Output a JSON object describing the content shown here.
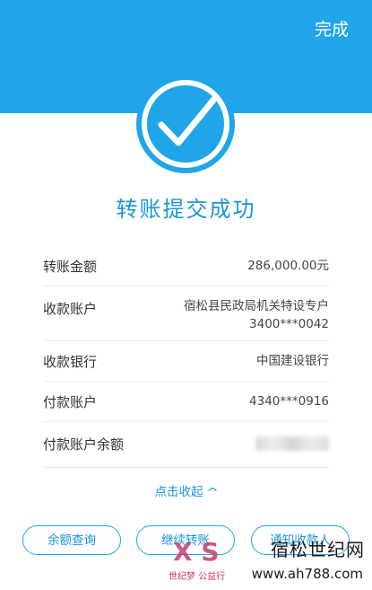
{
  "header": {
    "done_label": "完成"
  },
  "title": "转账提交成功",
  "rows": [
    {
      "label": "转账金额",
      "value": "286,000.00元"
    },
    {
      "label": "收款账户",
      "value_line1": "宿松县民政局机关特设专户",
      "value_line2": "3400***0042"
    },
    {
      "label": "收款银行",
      "value": "中国建设银行"
    },
    {
      "label": "付款账户",
      "value": "4340***0916"
    },
    {
      "label": "付款账户余额",
      "value": ""
    }
  ],
  "collapse_label": "点击收起",
  "buttons": {
    "balance_query": "余额查询",
    "continue_transfer": "继续转账",
    "notify_payee": "通知收款人"
  },
  "watermark": {
    "logo": "X S",
    "tag": "世纪梦 公益行",
    "brand": "宿松世纪网",
    "url": "www.ah788.com"
  },
  "colors": {
    "accent": "#1fa5e8",
    "text_accent": "#1a95d8"
  }
}
